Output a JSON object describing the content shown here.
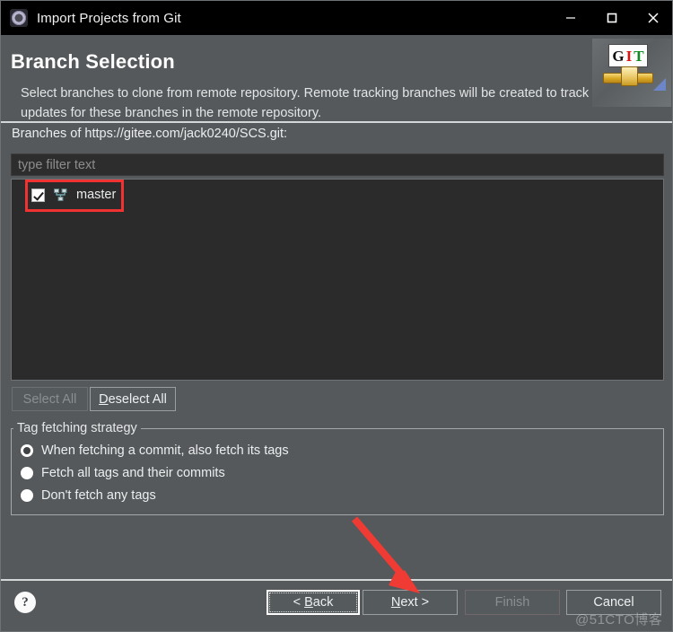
{
  "window": {
    "title": "Import Projects from Git",
    "icon": "gear-icon",
    "minimize_label": "—",
    "maximize_label": "□",
    "close_label": "✕"
  },
  "header": {
    "title": "Branch Selection",
    "description": "Select branches to clone from remote repository. Remote tracking branches will be created to track updates for these branches in the remote repository.",
    "logo": {
      "letters": [
        "G",
        "I",
        "T"
      ],
      "letter_colors": [
        "#111111",
        "#d41616",
        "#0f8a23"
      ]
    }
  },
  "body": {
    "branches_label": "Branches of https://gitee.com/jack0240/SCS.git:",
    "filter_placeholder": "type filter text",
    "filter_value": "",
    "branches": [
      {
        "name": "master",
        "checked": true,
        "icon": "branch-icon"
      }
    ],
    "select_all_label": "Select All",
    "select_all_enabled": false,
    "deselect_all_label": "Deselect All",
    "deselect_all_mnemonic": "D",
    "deselect_all_rest": "eselect All"
  },
  "tag_strategy": {
    "group_title": "Tag fetching strategy",
    "options": [
      {
        "label": "When fetching a commit, also fetch its tags",
        "selected": true
      },
      {
        "label": "Fetch all tags and their commits",
        "selected": false
      },
      {
        "label": "Don't fetch any tags",
        "selected": false
      }
    ]
  },
  "footer": {
    "help_label": "?",
    "back_prefix": "< ",
    "back_mnemonic": "B",
    "back_rest": "ack",
    "next_mnemonic": "N",
    "next_rest": "ext >",
    "finish_label": "Finish",
    "finish_enabled": false,
    "cancel_label": "Cancel"
  },
  "annotations": {
    "highlight_color": "#f03232",
    "arrow_color": "#ef3b33",
    "watermark": "@51CTO博客"
  }
}
